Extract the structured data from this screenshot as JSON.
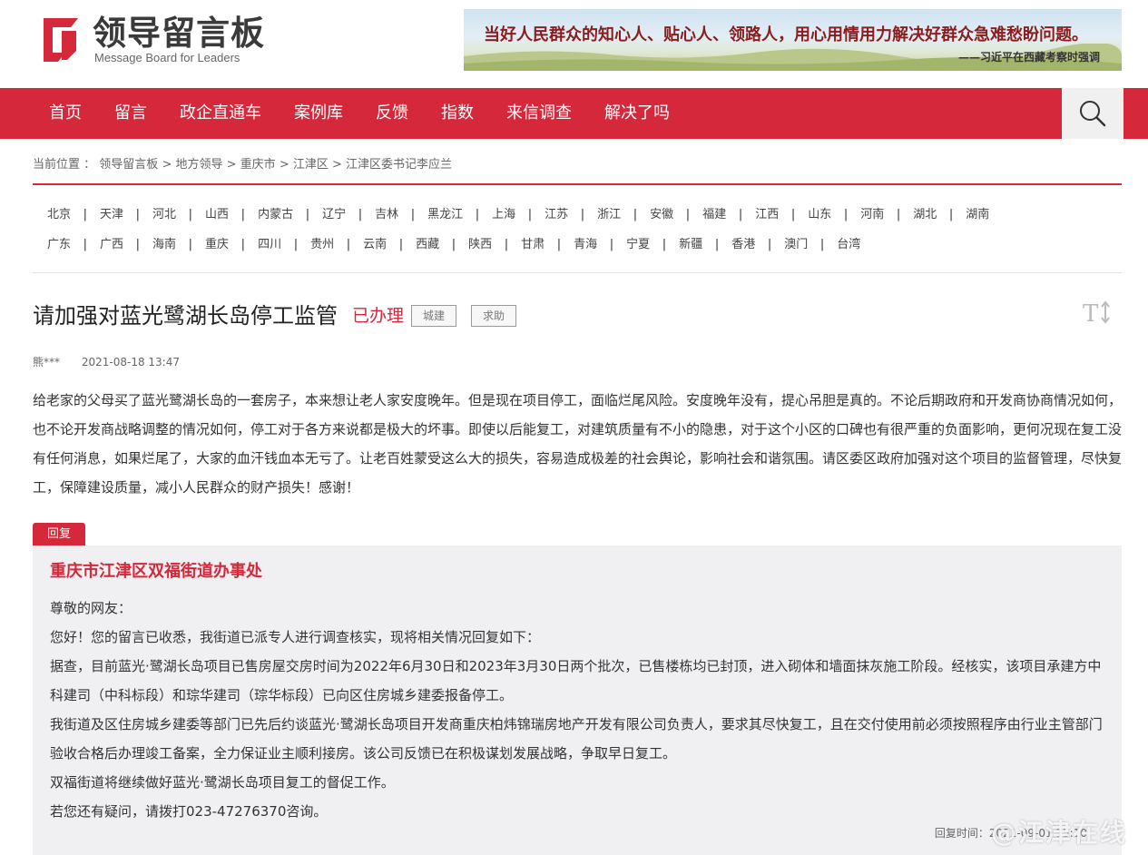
{
  "header": {
    "logo_title": "领导留言板",
    "logo_subtitle": "Message Board for Leaders",
    "banner_quote": "当好人民群众的知心人、贴心人、领路人，用心用情用力解决好群众急难愁盼问题。",
    "banner_author": "——习近平在西藏考察时强调"
  },
  "nav": {
    "items": [
      "首页",
      "留言",
      "政企直通车",
      "案例库",
      "反馈",
      "指数",
      "来信调查",
      "解决了吗"
    ],
    "search_icon": "search-icon"
  },
  "breadcrumb": {
    "label": "当前位置 ：",
    "items": [
      "领导留言板",
      "地方领导",
      "重庆市",
      "江津区",
      "江津区委书记李应兰"
    ],
    "separator": " > "
  },
  "provinces": {
    "row1": [
      "北京",
      "天津",
      "河北",
      "山西",
      "内蒙古",
      "辽宁",
      "吉林",
      "黑龙江",
      "上海",
      "江苏",
      "浙江",
      "安徽",
      "福建",
      "江西",
      "山东",
      "河南",
      "湖北",
      "湖南"
    ],
    "row2": [
      "广东",
      "广西",
      "海南",
      "重庆",
      "四川",
      "贵州",
      "云南",
      "西藏",
      "陕西",
      "甘肃",
      "青海",
      "宁夏",
      "新疆",
      "香港",
      "澳门",
      "台湾"
    ]
  },
  "message": {
    "title": "请加强对蓝光鹭湖长岛停工监管",
    "status": "已办理",
    "tags": [
      "城建",
      "求助"
    ],
    "author": "熊***",
    "time": "2021-08-18 13:47",
    "content": "给老家的父母买了蓝光鹭湖长岛的一套房子，本来想让老人家安度晚年。但是现在项目停工，面临烂尾风险。安度晚年没有，提心吊胆是真的。不论后期政府和开发商协商情况如何，也不论开发商战略调整的情况如何，停工对于各方来说都是极大的坏事。即使以后能复工，对建筑质量有不小的隐患，对于这个小区的口碑也有很严重的负面影响，更何况现在复工没有任何消息，如果烂尾了，大家的血汗钱血本无亏了。让老百姓蒙受这么大的损失，容易造成极差的社会舆论，影响社会和谐氛围。请区委区政府加强对这个项目的监督管理，尽快复工，保障建设质量，减小人民群众的财产损失！感谢！"
  },
  "reply": {
    "tab_label": "回复",
    "org": "重庆市江津区双福街道办事处",
    "paragraphs": [
      "尊敬的网友：",
      "您好！您的留言已收悉，我街道已派专人进行调查核实，现将相关情况回复如下：",
      "据查，目前蓝光·鹭湖长岛项目已售房屋交房时间为2022年6月30日和2023年3月30日两个批次，已售楼栋均已封顶，进入砌体和墙面抹灰施工阶段。经核实，该项目承建方中科建司（中科标段）和琮华建司（琮华标段）已向区住房城乡建委报备停工。",
      "我街道及区住房城乡建委等部门已先后约谈蓝光·鹭湖长岛项目开发商重庆柏炜锦瑞房地产开发有限公司负责人，要求其尽快复工，且在交付使用前必须按照程序由行业主管部门验收合格后办理竣工备案，全力保证业主顺利接房。该公司反馈已在积极谋划发展战略，争取早日复工。",
      "双福街道将继续做好蓝光·鹭湖长岛项目复工的督促工作。",
      "若您还有疑问，请拨打023-47276370咨询。"
    ],
    "time_label": "回复时间：",
    "time": "2021-09-01 15:10"
  },
  "watermark": "@江津在线",
  "font_icon": "font-size-icon"
}
